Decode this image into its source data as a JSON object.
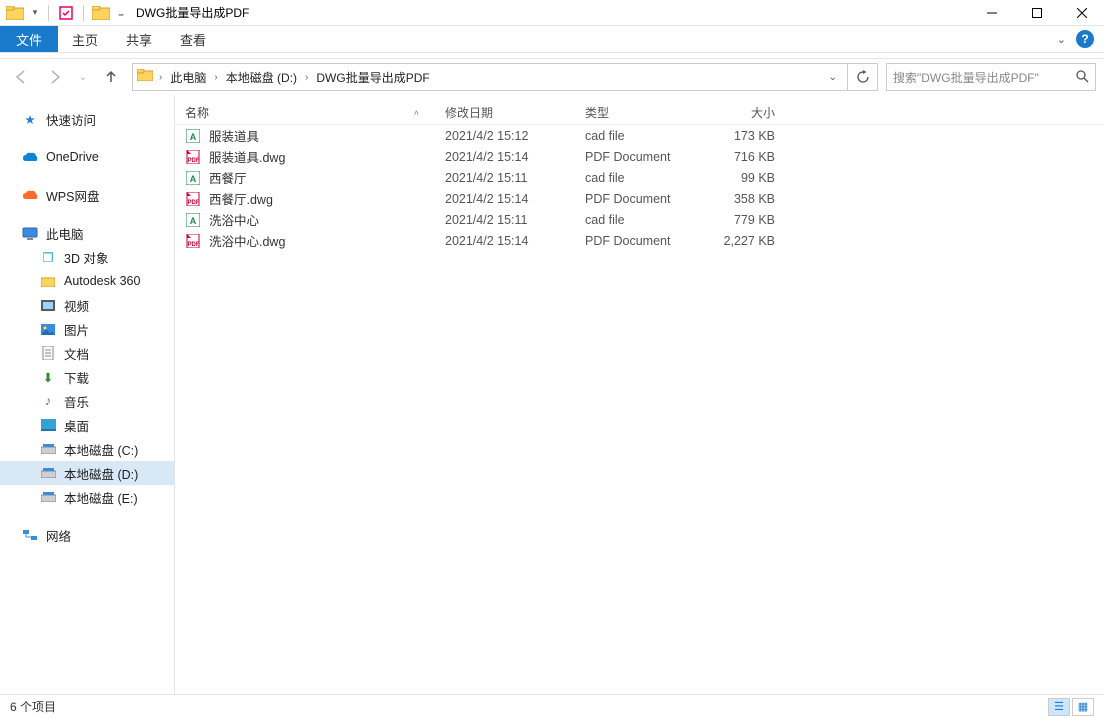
{
  "window": {
    "title": "DWG批量导出成PDF"
  },
  "ribbon": {
    "file": "文件",
    "home": "主页",
    "share": "共享",
    "view": "查看"
  },
  "breadcrumb": {
    "root": "此电脑",
    "drive": "本地磁盘 (D:)",
    "folder": "DWG批量导出成PDF"
  },
  "search": {
    "placeholder": "搜索\"DWG批量导出成PDF\""
  },
  "nav": {
    "quick_access": "快速访问",
    "onedrive": "OneDrive",
    "wps": "WPS网盘",
    "this_pc": "此电脑",
    "children": {
      "obj3d": "3D 对象",
      "autodesk": "Autodesk 360",
      "videos": "视频",
      "pictures": "图片",
      "documents": "文档",
      "downloads": "下载",
      "music": "音乐",
      "desktop": "桌面",
      "drive_c": "本地磁盘 (C:)",
      "drive_d": "本地磁盘 (D:)",
      "drive_e": "本地磁盘 (E:)"
    },
    "network": "网络"
  },
  "columns": {
    "name": "名称",
    "date": "修改日期",
    "type": "类型",
    "size": "大小"
  },
  "files": [
    {
      "icon": "cad",
      "name": "服装道具",
      "date": "2021/4/2 15:12",
      "type": "cad file",
      "size": "173 KB"
    },
    {
      "icon": "pdf",
      "name": "服装道具.dwg",
      "date": "2021/4/2 15:14",
      "type": "PDF Document",
      "size": "716 KB"
    },
    {
      "icon": "cad",
      "name": "西餐厅",
      "date": "2021/4/2 15:11",
      "type": "cad file",
      "size": "99 KB"
    },
    {
      "icon": "pdf",
      "name": "西餐厅.dwg",
      "date": "2021/4/2 15:14",
      "type": "PDF Document",
      "size": "358 KB"
    },
    {
      "icon": "cad",
      "name": "洗浴中心",
      "date": "2021/4/2 15:11",
      "type": "cad file",
      "size": "779 KB"
    },
    {
      "icon": "pdf",
      "name": "洗浴中心.dwg",
      "date": "2021/4/2 15:14",
      "type": "PDF Document",
      "size": "2,227 KB"
    }
  ],
  "status": {
    "count": "6 个项目"
  }
}
